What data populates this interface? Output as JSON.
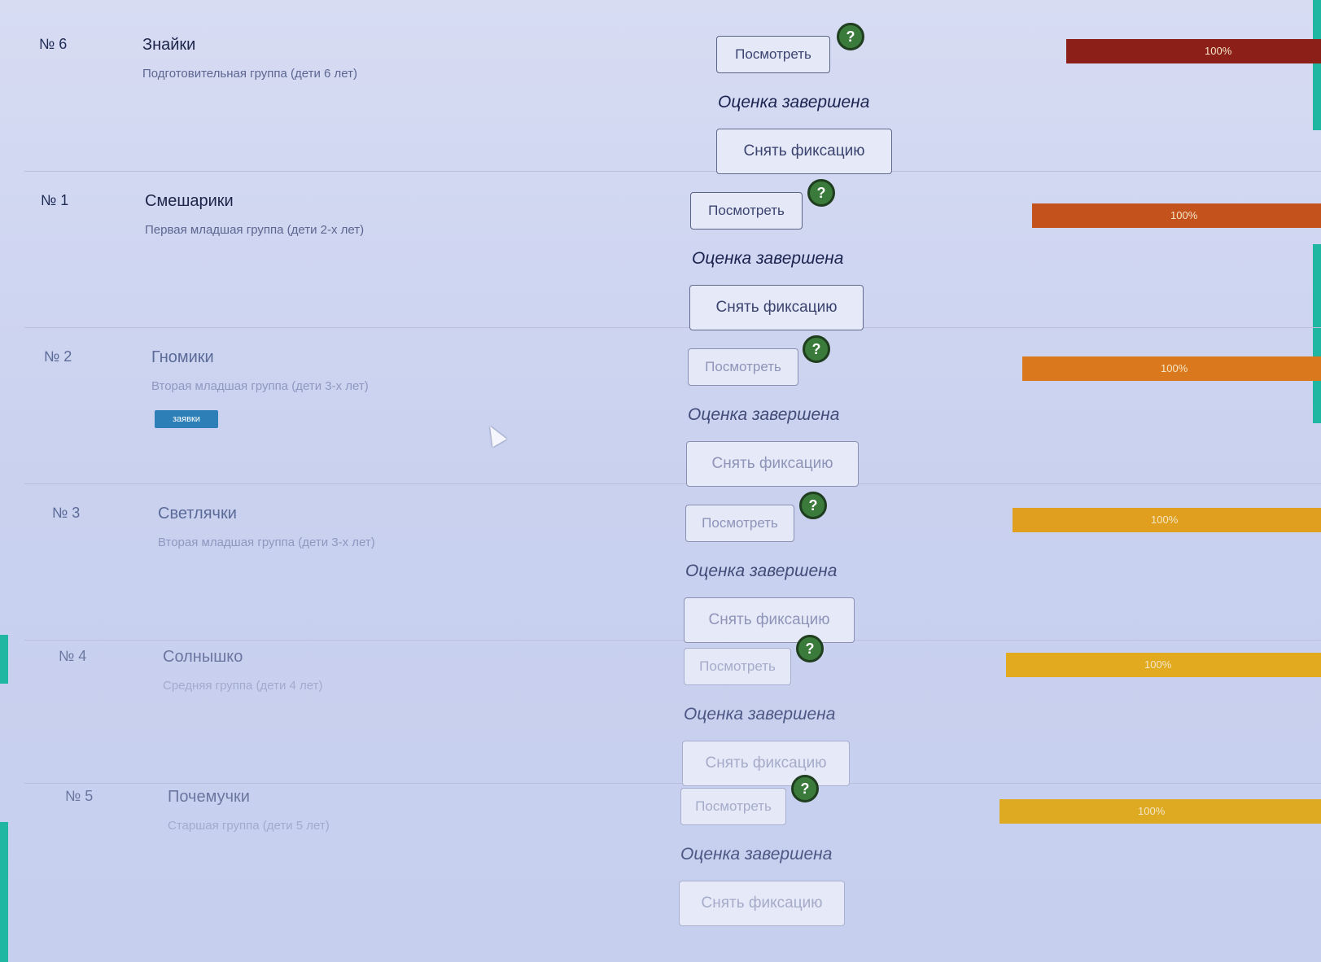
{
  "groups": [
    {
      "number": "№ 6",
      "name": "Знайки",
      "description": "Подготовительная группа (дети 6 лет)",
      "badge": "",
      "view_label": "Посмотреть",
      "help_icon": "question-icon",
      "status": "Оценка завершена",
      "unfix_label": "Снять фиксацию",
      "progress_percent": 100,
      "progress_label": "100%",
      "progress_color": "#8c2019"
    },
    {
      "number": "№ 1",
      "name": "Смешарики",
      "description": "Первая младшая группа (дети 2-х лет)",
      "badge": "",
      "view_label": "Посмотреть",
      "help_icon": "question-icon",
      "status": "Оценка завершена",
      "unfix_label": "Снять фиксацию",
      "progress_percent": 100,
      "progress_label": "100%",
      "progress_color": "#c4521d"
    },
    {
      "number": "№ 2",
      "name": "Гномики",
      "description": "Вторая младшая группа (дети 3-х лет)",
      "badge": "заявки",
      "view_label": "Посмотреть",
      "help_icon": "question-icon",
      "status": "Оценка завершена",
      "unfix_label": "Снять фиксацию",
      "progress_percent": 100,
      "progress_label": "100%",
      "progress_color": "#d9781d"
    },
    {
      "number": "№ 3",
      "name": "Светлячки",
      "description": "Вторая младшая группа (дети 3-х лет)",
      "badge": "",
      "view_label": "Посмотреть",
      "help_icon": "question-icon",
      "status": "Оценка завершена",
      "unfix_label": "Снять фиксацию",
      "progress_percent": 100,
      "progress_label": "100%",
      "progress_color": "#e09f1e"
    },
    {
      "number": "№ 4",
      "name": "Солнышко",
      "description": "Средняя группа (дети 4 лет)",
      "badge": "",
      "view_label": "Посмотреть",
      "help_icon": "question-icon",
      "status": "Оценка завершена",
      "unfix_label": "Снять фиксацию",
      "progress_percent": 100,
      "progress_label": "100%",
      "progress_color": "#e1aa1f"
    },
    {
      "number": "№ 5",
      "name": "Почемучки",
      "description": "Старшая группа (дети 5 лет)",
      "badge": "",
      "view_label": "Посмотреть",
      "help_icon": "question-icon",
      "status": "Оценка завершена",
      "unfix_label": "Снять фиксацию",
      "progress_percent": 100,
      "progress_label": "100%",
      "progress_color": "#ddaa22"
    }
  ]
}
